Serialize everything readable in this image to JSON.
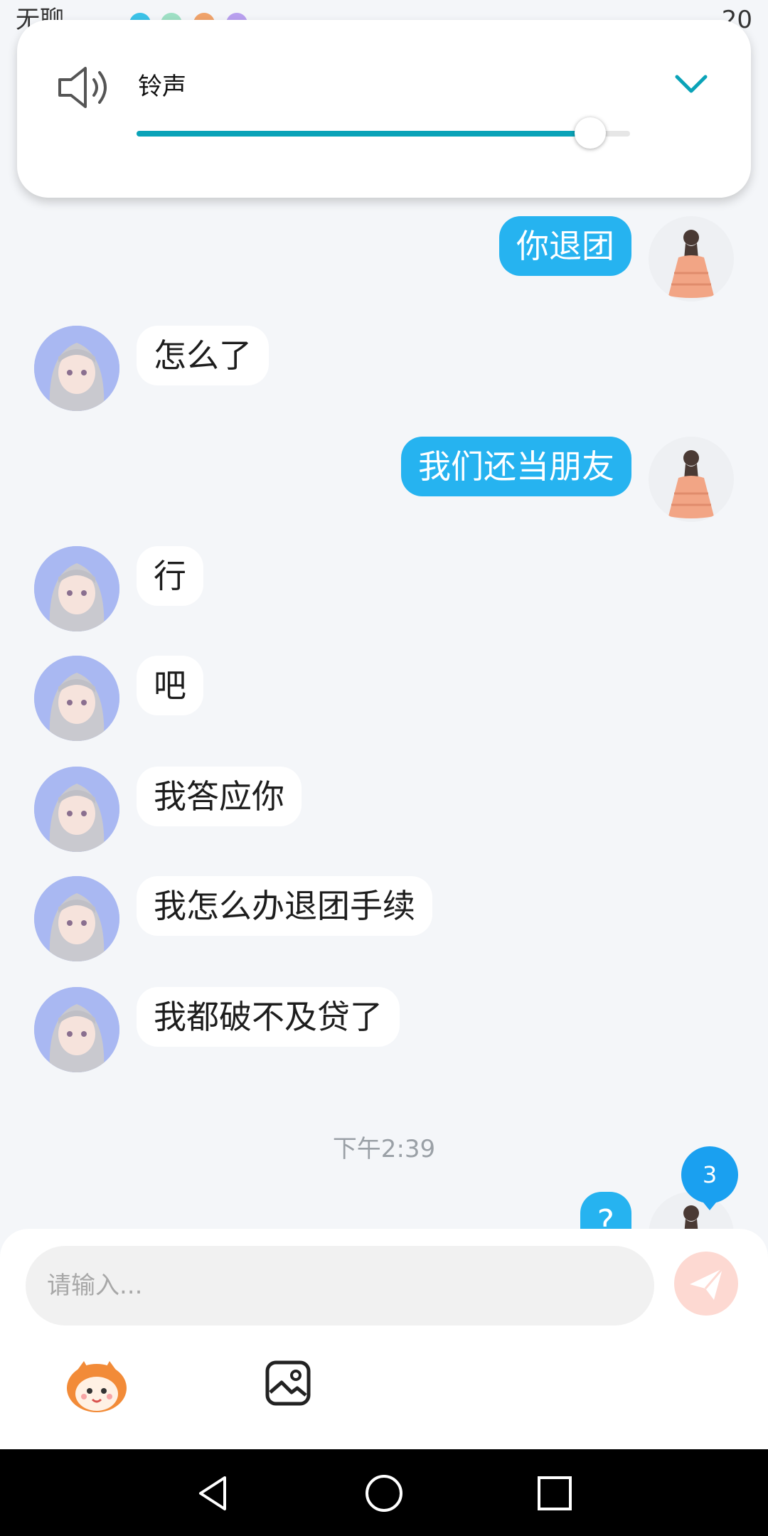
{
  "status_bar": {
    "left_text": "无聊",
    "right_text": "20"
  },
  "volume_panel": {
    "label": "铃声",
    "level_percent": 92,
    "accent_color": "#0aa3b8"
  },
  "messages": [
    {
      "side": "out",
      "text": "你退团"
    },
    {
      "side": "in",
      "text": "怎么了"
    },
    {
      "side": "out",
      "text": "我们还当朋友"
    },
    {
      "side": "in",
      "text": "行"
    },
    {
      "side": "in",
      "text": "吧"
    },
    {
      "side": "in",
      "text": "我答应你"
    },
    {
      "side": "in",
      "text": "我怎么办退团手续"
    },
    {
      "side": "in",
      "text": "我都破不及贷了"
    },
    {
      "side": "out",
      "text": "?"
    }
  ],
  "timestamp": "下午2:39",
  "unread_count": "3",
  "composer": {
    "placeholder": "请输入..."
  },
  "colors": {
    "outgoing_bubble": "#26b3f0",
    "incoming_bubble": "#ffffff",
    "badge": "#1aa0f0"
  }
}
